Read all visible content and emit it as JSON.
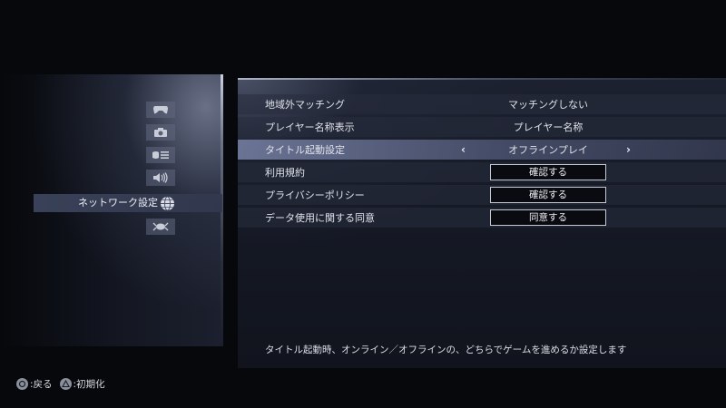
{
  "sidebar": {
    "items": [
      {
        "icon": "controller-icon"
      },
      {
        "icon": "camera-icon"
      },
      {
        "icon": "display-icon"
      },
      {
        "icon": "speaker-icon"
      },
      {
        "icon": "globe-icon",
        "label": "ネットワーク設定",
        "active": true
      },
      {
        "icon": "crab-icon"
      }
    ]
  },
  "settings": {
    "rows": [
      {
        "label": "地域外マッチング",
        "value": "マッチングしない"
      },
      {
        "label": "プレイヤー名称表示",
        "value": "プレイヤー名称"
      },
      {
        "label": "タイトル起動設定",
        "value": "オフラインプレイ",
        "selected": true
      },
      {
        "label": "利用規約",
        "button": "確認する"
      },
      {
        "label": "プライバシーポリシー",
        "button": "確認する"
      },
      {
        "label": "データ使用に関する同意",
        "button": "同意する"
      }
    ]
  },
  "description": "タイトル起動時、オンライン／オフラインの、どちらでゲームを進めるか設定します",
  "footer": {
    "back_label": ":戻る",
    "reset_label": ":初期化"
  },
  "colors": {
    "background": "#07080c",
    "panel": "#161a26",
    "selected_row": "#7882a5",
    "button_border": "#c4c8d4"
  }
}
